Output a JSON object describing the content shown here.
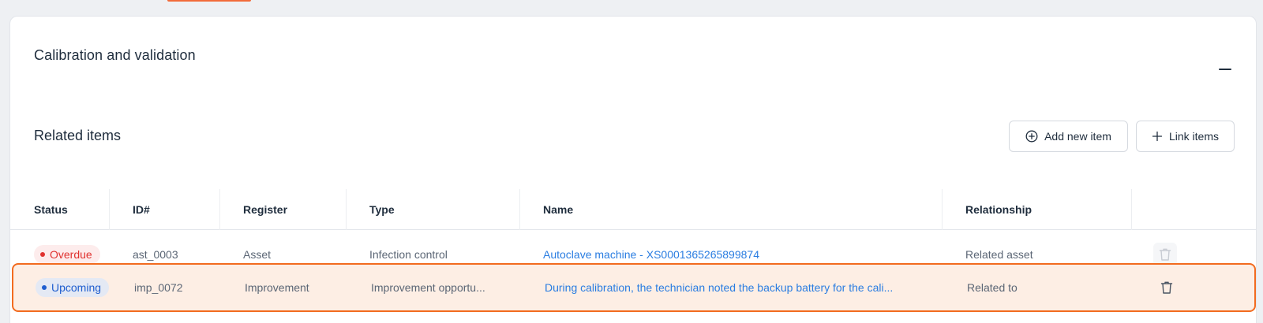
{
  "section": {
    "title": "Calibration and validation"
  },
  "related": {
    "title": "Related items",
    "add_button_label": "Add new item",
    "link_button_label": "Link items"
  },
  "table": {
    "columns": [
      "Status",
      "ID#",
      "Register",
      "Type",
      "Name",
      "Relationship"
    ],
    "rows": [
      {
        "status": "Overdue",
        "id": "ast_0003",
        "register": "Asset",
        "type": "Infection control",
        "name": "Autoclave machine - XS0001365265899874",
        "relationship": "Related asset"
      },
      {
        "status": "Upcoming",
        "id": "imp_0072",
        "register": "Improvement",
        "type": "Improvement opportu...",
        "name": "During calibration, the technician noted the backup battery for the cali...",
        "relationship": "Related to"
      }
    ]
  },
  "colors": {
    "accent": "#f26b1f",
    "link": "#2a7de1",
    "overdue": "#e0322f",
    "upcoming": "#1f5ecf",
    "selected_row_bg": "#fdeee4"
  },
  "icons": {
    "collapse": "minus-icon",
    "add": "plus-circle-icon",
    "link": "plus-icon",
    "delete": "trash-icon"
  }
}
